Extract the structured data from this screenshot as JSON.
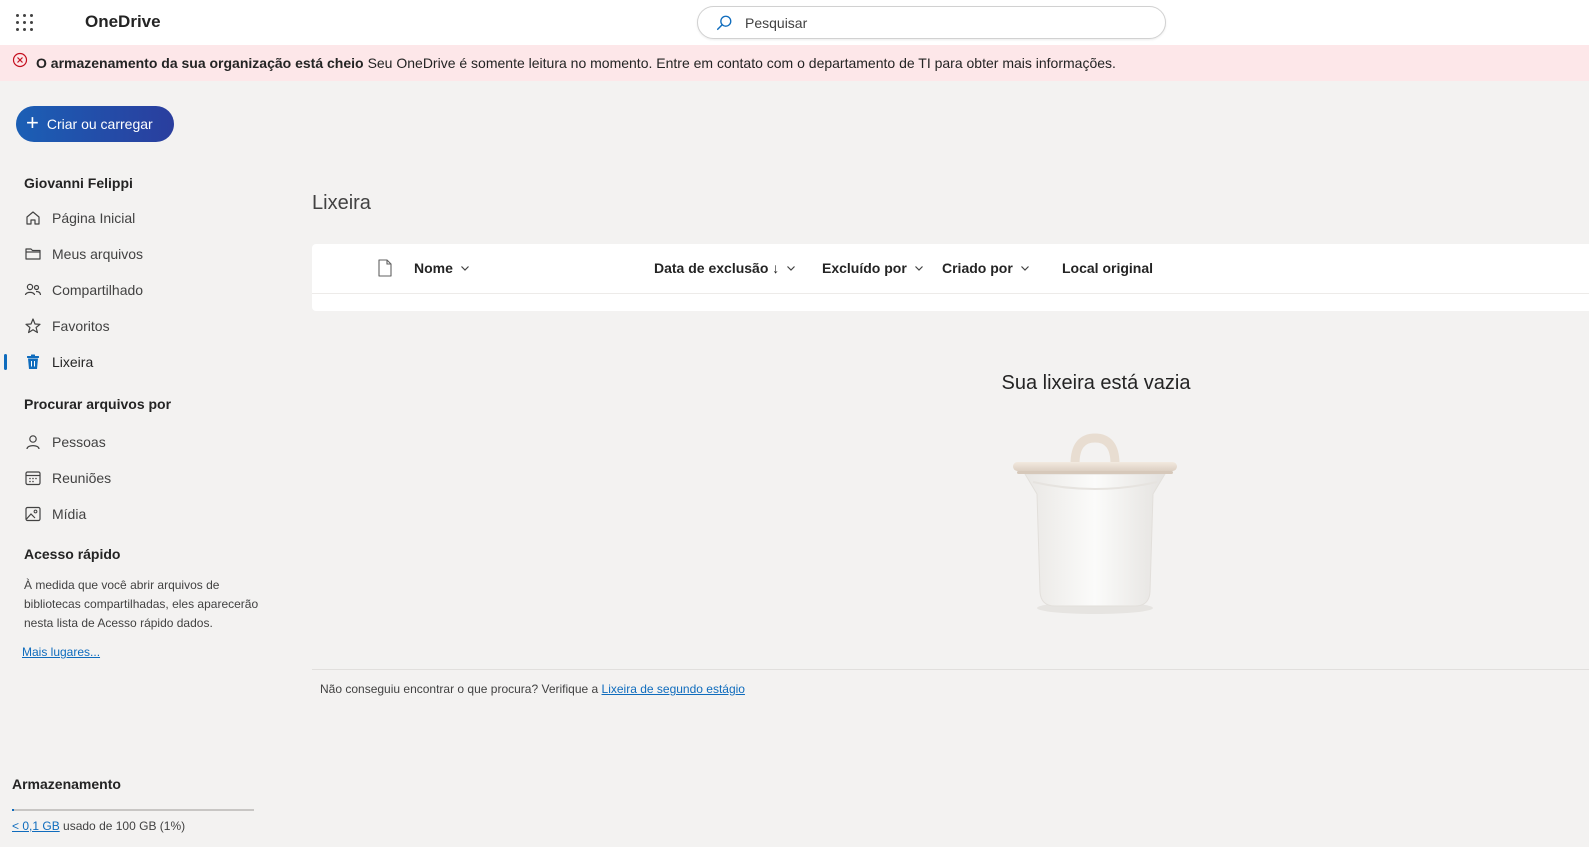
{
  "header": {
    "app_title": "OneDrive",
    "search_placeholder": "Pesquisar",
    "waffle_icon": "app-launcher-icon",
    "search_icon": "search-icon"
  },
  "banner": {
    "icon": "error-circle-icon",
    "title": "O armazenamento da sua organização está cheio",
    "message": "Seu OneDrive é somente leitura no momento. Entre em contato com o departamento de TI para obter mais informações.",
    "background": "#fde7e9"
  },
  "create_button": {
    "label": "Criar ou carregar"
  },
  "sidebar": {
    "user_name": "Giovanni Felippi",
    "items": [
      {
        "label": "Página Inicial",
        "icon": "home-icon"
      },
      {
        "label": "Meus arquivos",
        "icon": "folder-icon"
      },
      {
        "label": "Compartilhado",
        "icon": "people-icon"
      },
      {
        "label": "Favoritos",
        "icon": "star-icon"
      },
      {
        "label": "Lixeira",
        "icon": "trash-icon",
        "active": true
      }
    ],
    "browse_title": "Procurar arquivos por",
    "browse_items": [
      {
        "label": "Pessoas",
        "icon": "person-icon"
      },
      {
        "label": "Reuniões",
        "icon": "calendar-icon"
      },
      {
        "label": "Mídia",
        "icon": "image-icon"
      }
    ],
    "quick_access": {
      "title": "Acesso rápido",
      "text": "À medida que você abrir arquivos de bibliotecas compartilhadas, eles aparecerão nesta lista de Acesso rápido dados.",
      "more_link": "Mais lugares..."
    },
    "storage": {
      "title": "Armazenamento",
      "used_link": "< 0,1 GB",
      "used_text": " usado de 100 GB (1%)",
      "fraction_used": 0.01
    }
  },
  "main": {
    "title": "Lixeira",
    "columns": [
      {
        "label": "Nome",
        "chevron": true
      },
      {
        "label": "Data de exclusão ↓",
        "chevron": true
      },
      {
        "label": "Excluído por",
        "chevron": true
      },
      {
        "label": "Criado por",
        "chevron": true
      },
      {
        "label": "Local original",
        "chevron": false
      }
    ],
    "empty_title": "Sua lixeira está vazia",
    "empty_illustration": "empty-trash-illustration",
    "footer_text": "Não conseguiu encontrar o que procura? Verifique a ",
    "footer_link": "Lixeira de segundo estágio"
  },
  "colors": {
    "accent": "#0f6cbd",
    "button_gradient_start": "#1b5fb5",
    "button_gradient_end": "#2a3e9e",
    "background": "#f3f2f1"
  }
}
